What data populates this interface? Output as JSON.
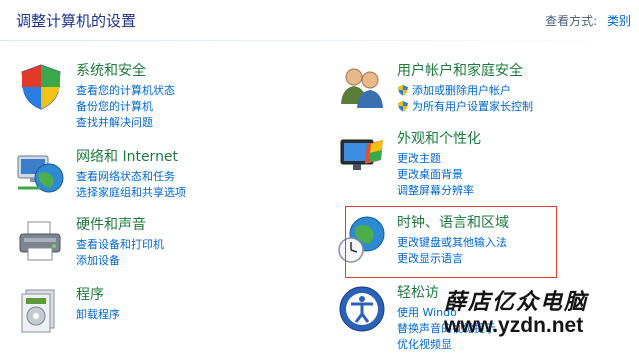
{
  "header": {
    "title": "调整计算机的设置",
    "view_by_label": "查看方式:",
    "view_by_value": "类别"
  },
  "categories": [
    {
      "title": "系统和安全",
      "icon": "shield-icon",
      "links": [
        "查看您的计算机状态",
        "备份您的计算机",
        "查找并解决问题"
      ]
    },
    {
      "title": "网络和 Internet",
      "icon": "network-globe-icon",
      "links": [
        "查看网络状态和任务",
        "选择家庭组和共享选项"
      ]
    },
    {
      "title": "硬件和声音",
      "icon": "printer-icon",
      "links": [
        "查看设备和打印机",
        "添加设备"
      ]
    },
    {
      "title": "程序",
      "icon": "programs-icon",
      "links": [
        "卸载程序"
      ]
    },
    {
      "title": "用户帐户和家庭安全",
      "icon": "users-icon",
      "links": [
        "添加或删除用户帐户",
        "为所有用户设置家长控制"
      ]
    },
    {
      "title": "外观和个性化",
      "icon": "appearance-icon",
      "links": [
        "更改主题",
        "更改桌面背景",
        "调整屏幕分辨率"
      ]
    },
    {
      "title": "时钟、语言和区域",
      "icon": "clock-globe-icon",
      "links": [
        "更改键盘或其他输入法",
        "更改显示语言"
      ]
    },
    {
      "title": "轻松访",
      "icon": "ease-of-access-icon",
      "links": [
        "使用 Windo",
        "替换声音的视觉提示",
        "优化视频显"
      ]
    }
  ],
  "watermark": {
    "line1": "薛店亿众电脑",
    "line2": "www.yzdn.net"
  },
  "colors": {
    "category_title": "#1e7a3c",
    "link": "#0066cc",
    "page_title": "#1e3287",
    "highlight": "#e03c3c"
  }
}
